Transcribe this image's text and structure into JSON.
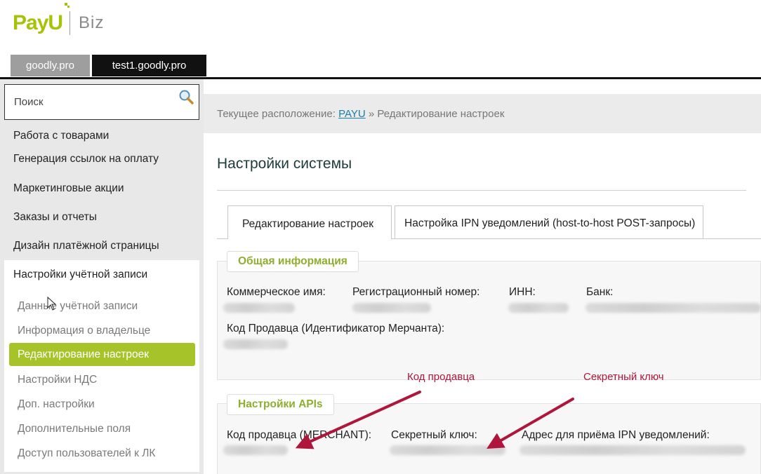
{
  "header": {
    "logo_text": "PayU",
    "logo_product": "Biz",
    "site_tabs": [
      "goodly.pro",
      "test1.goodly.pro"
    ]
  },
  "sidebar": {
    "search_placeholder": "Поиск",
    "menu": [
      "Работа с товарами",
      "Генерация ссылок на оплату",
      "Маркетинговые акции",
      "Заказы и отчеты",
      "Дизайн платёжной страницы",
      "Настройки учётной записи"
    ],
    "submenu": [
      "Данные учётной записи",
      "Информация о владельце",
      "Редактирование настроек",
      "Настройки НДС",
      "Доп. настройки",
      "Дополнительные поля",
      "Доступ пользователей к ЛК"
    ],
    "active_submenu_index": 2
  },
  "breadcrumb": {
    "prefix": "Текущее расположение:",
    "link": "PAYU",
    "separator": "»",
    "current": "Редактирование настроек"
  },
  "main": {
    "title": "Настройки системы",
    "tabs": [
      "Редактирование настроек",
      "Настройка IPN уведомлений (host-to-host POST-запросы)"
    ],
    "general_section": {
      "legend": "Общая информация",
      "fields": [
        "Коммерческое имя:",
        "Регистрационный номер:",
        "ИНН:",
        "Банк:"
      ],
      "merchant_code_label": "Код Продавца (Идентификатор Мерчанта):"
    },
    "api_section": {
      "legend": "Настройки APIs",
      "fields": [
        "Код продавца (MERCHANT):",
        "Секретный ключ:",
        "Адрес для приёма IPN уведомлений:"
      ]
    }
  },
  "annotations": {
    "merchant_code": "Код продавца",
    "secret_key": "Секретный ключ",
    "color": "#b0153b"
  },
  "colors": {
    "brand_green": "#a6c307",
    "active_menu_bg": "#a6c42a",
    "legend_text": "#8fae2e",
    "link": "#1a7fa8"
  }
}
